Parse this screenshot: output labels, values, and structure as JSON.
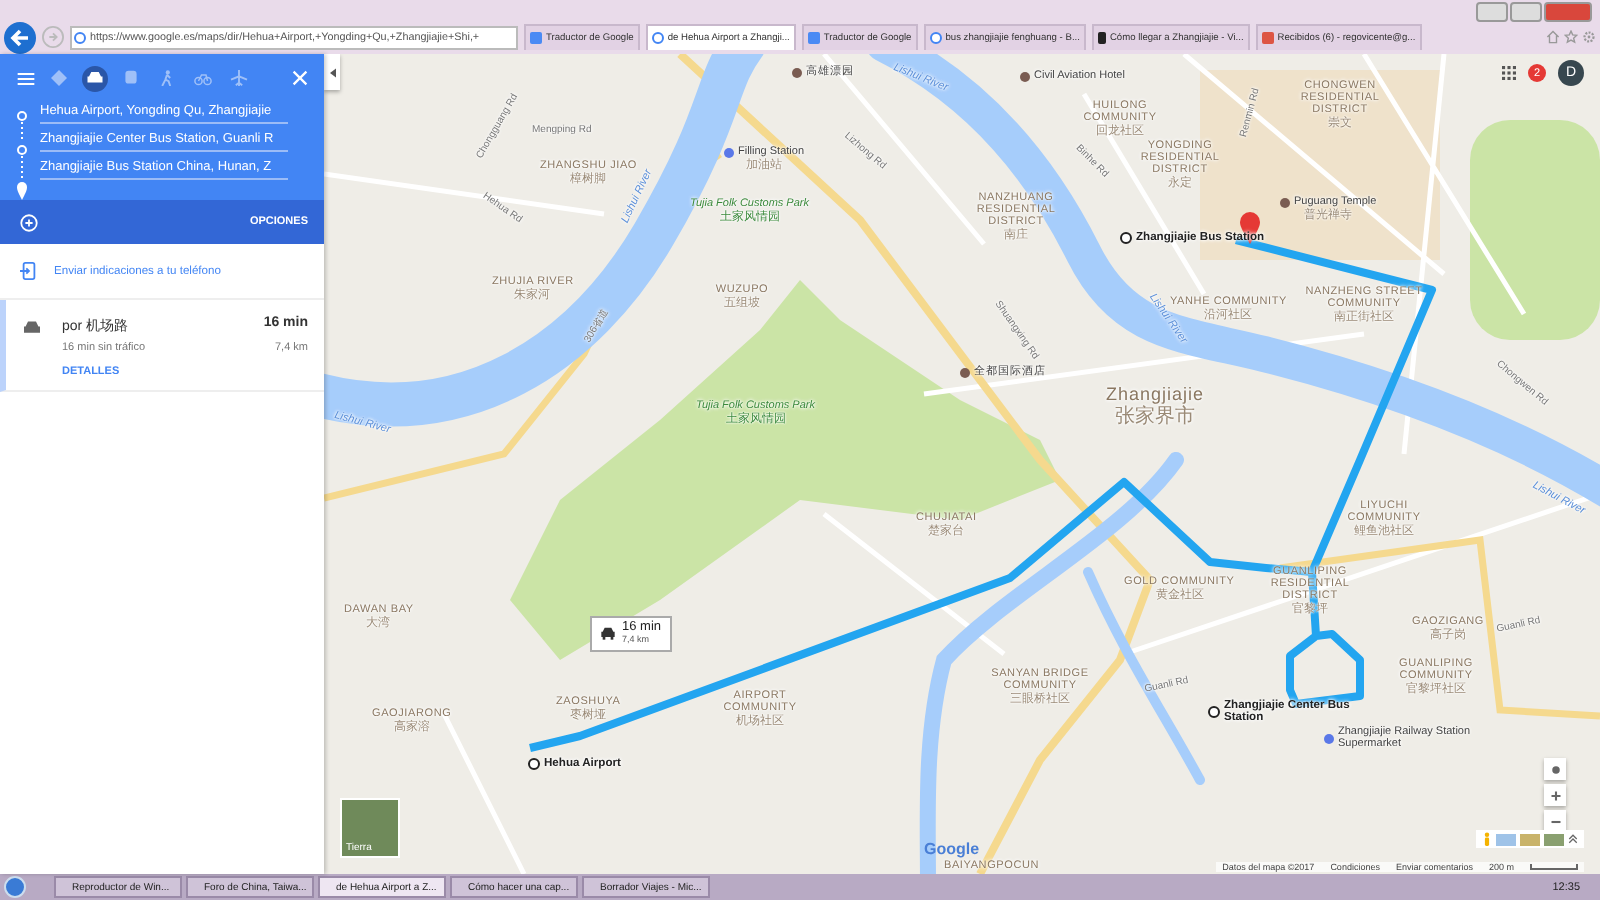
{
  "browser": {
    "url": "https://www.google.es/maps/dir/Hehua+Airport,+Yongding+Qu,+Zhangjiajie+Shi,+",
    "tabs": [
      {
        "title": "Traductor de Google",
        "selected": false
      },
      {
        "title": "de Hehua Airport a Zhangji...",
        "selected": true
      },
      {
        "title": "Traductor de Google",
        "selected": false
      },
      {
        "title": "bus zhangjiajie fenghuang - B...",
        "selected": false
      },
      {
        "title": "Cómo llegar a Zhangjiajie - Vi...",
        "selected": false
      },
      {
        "title": "Recibidos (6) - regovicente@g...",
        "selected": false
      }
    ]
  },
  "directions": {
    "modes": [
      {
        "kind": "best",
        "selected": false
      },
      {
        "kind": "car",
        "selected": true
      },
      {
        "kind": "transit",
        "selected": false
      },
      {
        "kind": "walk",
        "selected": false
      },
      {
        "kind": "bike",
        "selected": false
      },
      {
        "kind": "flight",
        "selected": false
      }
    ],
    "stops": [
      "Hehua Airport, Yongding Qu, Zhangjiajie",
      "Zhangjiajie Center Bus Station, Guanli R",
      "Zhangjiajie Bus Station China, Hunan, Z"
    ],
    "options_label": "OPCIONES",
    "send_link": "Enviar indicaciones a tu teléfono",
    "route": {
      "via": "por 机场路",
      "duration": "16 min",
      "no_traffic": "16 min sin tráfico",
      "distance": "7,4 km",
      "details": "DETALLES"
    }
  },
  "map": {
    "labels": [
      {
        "kind": "poi",
        "text": "高雄漂园"
      },
      {
        "kind": "poi",
        "text": "Civil Aviation Hotel"
      },
      {
        "kind": "river",
        "text": "Lishui River"
      },
      {
        "kind": "road",
        "text": "Chongguang Rd"
      },
      {
        "kind": "road",
        "text": "Mengping Rd"
      },
      {
        "kind": "fuel",
        "text": "Filling Station",
        "sub": "加油站"
      },
      {
        "kind": "area",
        "text": "ZHANGSHU JIAO",
        "sub": "樟树脚"
      },
      {
        "kind": "road",
        "text": "Hehua Rd"
      },
      {
        "kind": "road",
        "text": "Lizhong Rd"
      },
      {
        "kind": "area",
        "text": "HUILONG COMMUNITY",
        "sub": "回龙社区"
      },
      {
        "kind": "road",
        "text": "Binhe Rd"
      },
      {
        "kind": "area",
        "text": "CHONGWEN RESIDENTIAL DISTRICT",
        "sub": "崇文"
      },
      {
        "kind": "area",
        "text": "YONGDING RESIDENTIAL DISTRICT",
        "sub": "永定"
      },
      {
        "kind": "road",
        "text": "Renmin Rd"
      },
      {
        "kind": "park",
        "text": "Tujia Folk Customs Park",
        "sub": "土家风情园"
      },
      {
        "kind": "area",
        "text": "NANZHUANG RESIDENTIAL DISTRICT",
        "sub": "南庄"
      },
      {
        "kind": "poi",
        "text": "Puguang Temple",
        "sub": "普光禅寺"
      },
      {
        "kind": "stop",
        "text": "Zhangjiajie Bus Station"
      },
      {
        "kind": "area",
        "text": "ZHUJIA RIVER",
        "sub": "朱家河"
      },
      {
        "kind": "area",
        "text": "WUZUPO",
        "sub": "五组坡"
      },
      {
        "kind": "road",
        "text": "Shuangxing Rd"
      },
      {
        "kind": "river",
        "text": "Lishui River"
      },
      {
        "kind": "river",
        "text": "Lishui River"
      },
      {
        "kind": "area",
        "text": "YANHE COMMUNITY",
        "sub": "沿河社区"
      },
      {
        "kind": "area",
        "text": "NANZHENG STREET COMMUNITY",
        "sub": "南正街社区"
      },
      {
        "kind": "road",
        "text": "Chongwen Rd"
      },
      {
        "kind": "poi",
        "text": "全都国际酒店"
      },
      {
        "kind": "park",
        "text": "Tujia Folk Customs Park",
        "sub": "土家风情园"
      },
      {
        "kind": "city",
        "text": "Zhangjiajie",
        "sub": "张家界市"
      },
      {
        "kind": "river",
        "text": "Lishui River"
      },
      {
        "kind": "road",
        "text": "306省道"
      },
      {
        "kind": "area",
        "text": "CHUJIATAI",
        "sub": "楚家台"
      },
      {
        "kind": "area",
        "text": "LIYUCHI COMMUNITY",
        "sub": "鲤鱼池社区"
      },
      {
        "kind": "river",
        "text": "Lishui River"
      },
      {
        "kind": "area",
        "text": "DAWAN BAY",
        "sub": "大湾"
      },
      {
        "kind": "area",
        "text": "GOLD COMMUNITY",
        "sub": "黄金社区"
      },
      {
        "kind": "area",
        "text": "GUANLIPING RESIDENTIAL DISTRICT",
        "sub": "官黎坪"
      },
      {
        "kind": "area",
        "text": "GAOZIGANG",
        "sub": "高子岗"
      },
      {
        "kind": "road",
        "text": "Guanli Rd"
      },
      {
        "kind": "area",
        "text": "SANYAN BRIDGE COMMUNITY",
        "sub": "三眼桥社区"
      },
      {
        "kind": "area",
        "text": "GUANLIPING COMMUNITY",
        "sub": "官黎坪社区"
      },
      {
        "kind": "area",
        "text": "ZAOSHUYA",
        "sub": "枣树垭"
      },
      {
        "kind": "area",
        "text": "AIRPORT COMMUNITY",
        "sub": "机场社区"
      },
      {
        "kind": "area",
        "text": "GAOJIARONG",
        "sub": "高家溶"
      },
      {
        "kind": "road",
        "text": "Guanli Rd"
      },
      {
        "kind": "stop",
        "text": "Zhangjiajie Center Bus Station"
      },
      {
        "kind": "poi2",
        "text": "Zhangjiajie Railway Station Supermarket"
      },
      {
        "kind": "stop",
        "text": "Hehua Airport"
      },
      {
        "kind": "area",
        "text": "BAIYANGPOCUN"
      }
    ],
    "callout": {
      "duration": "16 min",
      "distance": "7,4 km"
    },
    "notifications": "2",
    "avatar": "D",
    "layer_label": "Tierra",
    "logo": "Google",
    "footer": [
      "Datos del mapa ©2017",
      "Condiciones",
      "Enviar comentarios"
    ],
    "scale": "200 m"
  },
  "taskbar": {
    "items": [
      {
        "title": "Reproductor de Win...",
        "selected": false
      },
      {
        "title": "Foro de China, Taiwa...",
        "selected": false
      },
      {
        "title": "de Hehua Airport a Z...",
        "selected": true
      },
      {
        "title": "Cómo hacer una cap...",
        "selected": false
      },
      {
        "title": "Borrador Viajes - Mic...",
        "selected": false
      }
    ],
    "clock": "12:35"
  }
}
